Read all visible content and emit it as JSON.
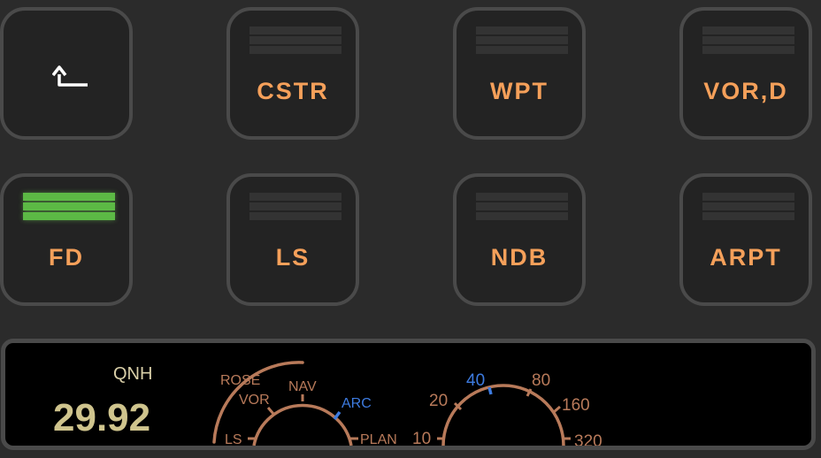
{
  "keys": [
    {
      "label": "",
      "icon": "return-arrow-icon",
      "light": "none"
    },
    {
      "label": "CSTR",
      "light": "off"
    },
    {
      "label": "WPT",
      "light": "off"
    },
    {
      "label": "VOR,D",
      "light": "off"
    },
    {
      "label": "FD",
      "light": "on"
    },
    {
      "label": "LS",
      "light": "off"
    },
    {
      "label": "NDB",
      "light": "off"
    },
    {
      "label": "ARPT",
      "light": "off"
    }
  ],
  "display": {
    "qnh_label": "QNH",
    "qnh_value": "29.92",
    "mode_selector": {
      "options": [
        "LS",
        "VOR",
        "NAV",
        "ARC",
        "PLAN"
      ],
      "group_label": "ROSE",
      "selected": "ARC"
    },
    "range_selector": {
      "options": [
        "10",
        "20",
        "40",
        "80",
        "160",
        "320"
      ],
      "selected": "40"
    }
  },
  "colors": {
    "label_orange": "#f5a05a",
    "light_green": "#5cb945",
    "selected_blue": "#3d7be0",
    "dial_brown": "#b87a5a",
    "qnh_text": "#cfc48d"
  }
}
